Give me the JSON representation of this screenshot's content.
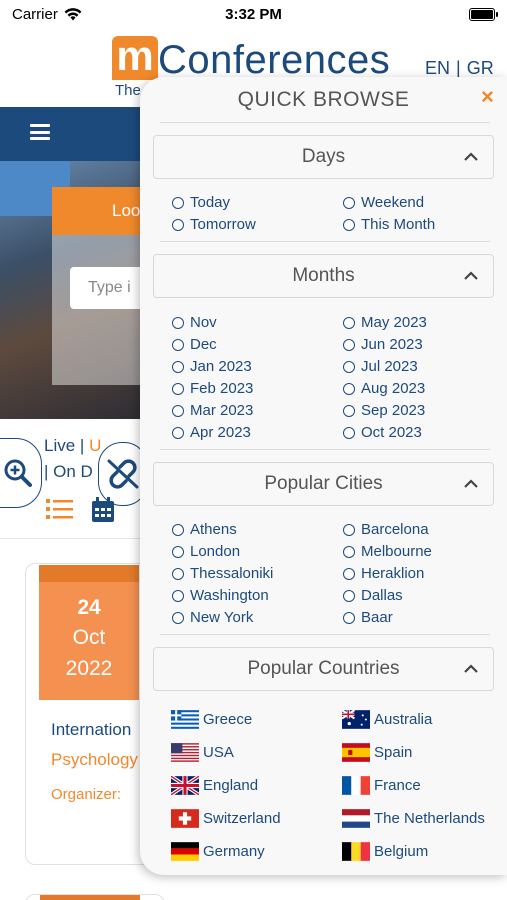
{
  "status_bar": {
    "carrier": "Carrier",
    "time": "3:32 PM"
  },
  "header": {
    "logo_letter": "m",
    "logo_word": "Conferences",
    "tagline": "The",
    "lang_en": "EN",
    "lang_sep": "|",
    "lang_gr": "GR"
  },
  "background": {
    "hero_button": "Loo",
    "search_placeholder": "Type i",
    "live_label": "Live",
    "sep": "|",
    "upcoming_partial": "U",
    "ondemand_partial": "| On D",
    "event": {
      "day": "24",
      "month": "Oct",
      "year": "2022",
      "title": "Internation",
      "category": "Psychology",
      "organizer_label": "Organizer:"
    }
  },
  "quick_browse": {
    "title": "QUICK BROWSE",
    "close": "×",
    "days": {
      "header": "Days",
      "options": [
        "Today",
        "Weekend",
        "Tomorrow",
        "This Month"
      ]
    },
    "months": {
      "header": "Months",
      "options": [
        "Nov",
        "May 2023",
        "Dec",
        "Jun 2023",
        "Jan 2023",
        "Jul 2023",
        "Feb 2023",
        "Aug 2023",
        "Mar 2023",
        "Sep 2023",
        "Apr 2023",
        "Oct 2023"
      ]
    },
    "cities": {
      "header": "Popular Cities",
      "options": [
        "Athens",
        "Barcelona",
        "London",
        "Melbourne",
        "Thessaloniki",
        "Heraklion",
        "Washington",
        "Dallas",
        "New York",
        "Baar"
      ]
    },
    "countries": {
      "header": "Popular Countries",
      "options": [
        "Greece",
        "Australia",
        "USA",
        "Spain",
        "England",
        "France",
        "Switzerland",
        "The Netherlands",
        "Germany",
        "Belgium"
      ],
      "flag_icons": [
        "greece-flag-icon",
        "australia-flag-icon",
        "usa-flag-icon",
        "spain-flag-icon",
        "england-flag-icon",
        "france-flag-icon",
        "switzerland-flag-icon",
        "netherlands-flag-icon",
        "germany-flag-icon",
        "belgium-flag-icon"
      ]
    }
  },
  "colors": {
    "brand_orange": "#f0892c",
    "brand_navy": "#1d4a7c"
  }
}
